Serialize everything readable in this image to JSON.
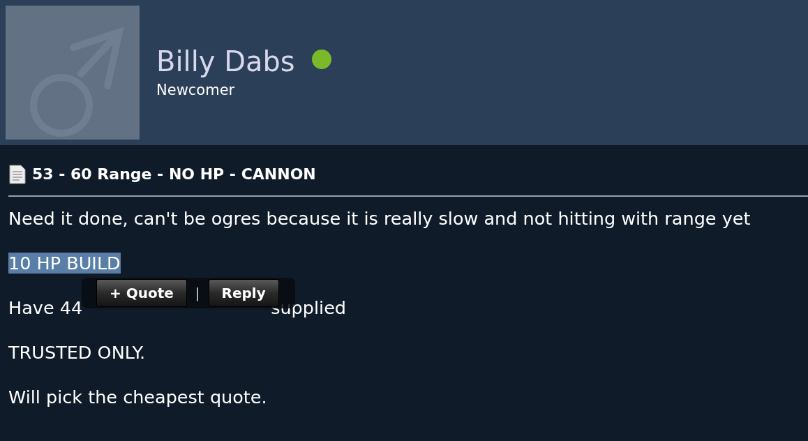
{
  "profile": {
    "name": "Billy Dabs",
    "online": true,
    "rank": "Newcomer"
  },
  "thread": {
    "title": "53 - 60 Range - NO HP - CANNON"
  },
  "post": {
    "paragraphs": [
      {
        "kind": "text",
        "text": "Need it done, can't be ogres because it is really slow and not hitting with range yet",
        "selected": false
      },
      {
        "kind": "text",
        "text": "10 HP BUILD",
        "selected": true
      },
      {
        "kind": "covered",
        "visible_start": "Have 44",
        "visible_end": "supplied"
      },
      {
        "kind": "text",
        "text": "TRUSTED ONLY.",
        "selected": false
      },
      {
        "kind": "blank"
      },
      {
        "kind": "text",
        "text": "Will pick the cheapest quote.",
        "selected": false
      }
    ]
  },
  "selection_popup": {
    "buttons": [
      "+ Quote",
      "Reply"
    ],
    "separator": "|"
  }
}
